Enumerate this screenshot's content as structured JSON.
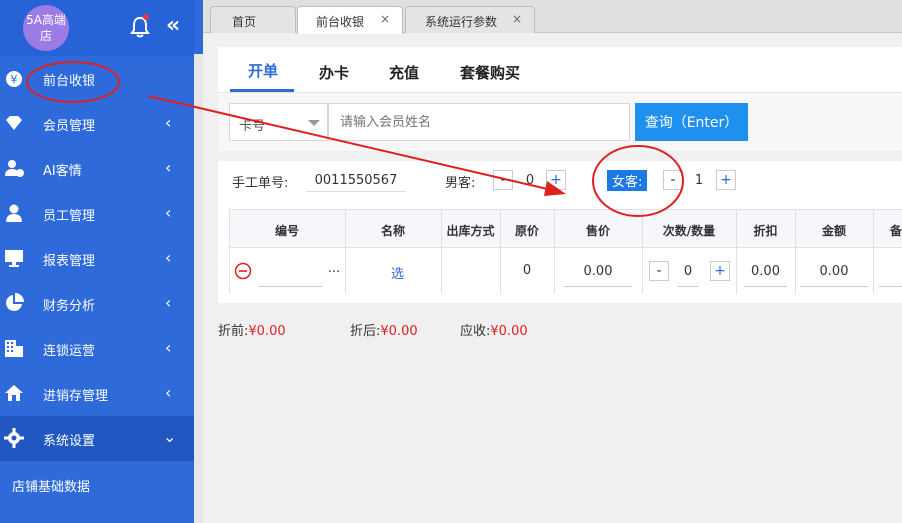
{
  "sidebar": {
    "logo": "5A高端店",
    "collapse_icon": "double-chevron-left-icon",
    "items": [
      {
        "label": "前台收银",
        "icon": "yen-coin-icon"
      },
      {
        "label": "会员管理",
        "icon": "diamond-icon"
      },
      {
        "label": "AI客情",
        "icon": "user-alert-icon"
      },
      {
        "label": "员工管理",
        "icon": "user-icon"
      },
      {
        "label": "报表管理",
        "icon": "monitor-icon"
      },
      {
        "label": "财务分析",
        "icon": "pie-chart-icon"
      },
      {
        "label": "连锁运营",
        "icon": "building-icon"
      },
      {
        "label": "进销存管理",
        "icon": "house-icon"
      },
      {
        "label": "系统设置",
        "icon": "gear-icon"
      }
    ],
    "submenu": {
      "label": "店铺基础数据"
    }
  },
  "tabs": [
    {
      "label": "首页"
    },
    {
      "label": "前台收银",
      "close": "×"
    },
    {
      "label": "系统运行参数",
      "close": "×"
    }
  ],
  "subtabs": [
    "开单",
    "办卡",
    "充值",
    "套餐购买"
  ],
  "search": {
    "select_value": "卡号",
    "placeholder": "请输入会员姓名",
    "button": "查询（Enter）"
  },
  "form": {
    "manual_label": "手工单号:",
    "manual_value": "0011550567",
    "male_label": "男客:",
    "male_count": "0",
    "female_label": "女客:",
    "female_count": "1",
    "minus": "-",
    "plus": "+"
  },
  "table": {
    "headers": [
      "编号",
      "名称",
      "出库方式",
      "原价",
      "售价",
      "次数/数量",
      "折扣",
      "金额",
      "备"
    ],
    "row": {
      "more": "...",
      "name_link": "选",
      "orig_price": "0",
      "sale_price": "0.00",
      "qty": "0",
      "discount": "0.00",
      "amount": "0.00"
    }
  },
  "totals": {
    "before_label": "折前:",
    "before_value": "¥0.00",
    "after_label": "折后:",
    "after_value": "¥0.00",
    "due_label": "应收:",
    "due_value": "¥0.00"
  },
  "colors": {
    "sidebar": "#2e6ad9",
    "accent": "#1e90f0",
    "annotation": "#e02020"
  }
}
